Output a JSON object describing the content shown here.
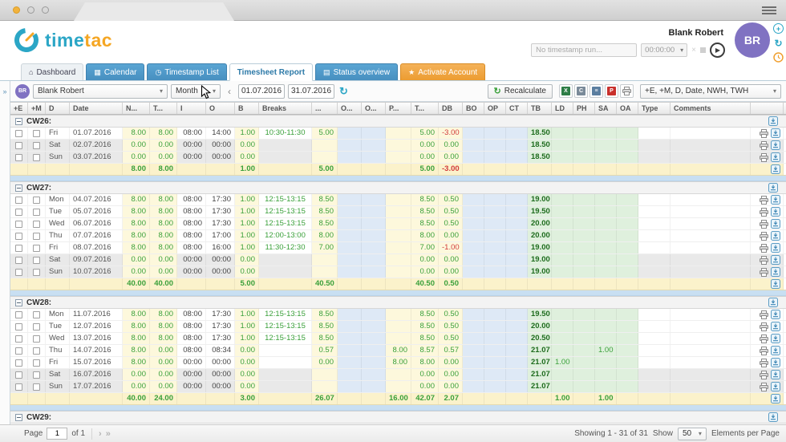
{
  "header": {
    "logo_time": "time",
    "logo_tac": "tac",
    "user_name": "Blank Robert",
    "avatar_initials": "BR",
    "timer_placeholder": "No timestamp run...",
    "timer_value": "00:00:00"
  },
  "tabs": [
    {
      "label": "Dashboard",
      "icon": "dashboard-icon"
    },
    {
      "label": "Calendar",
      "icon": "calendar-icon"
    },
    {
      "label": "Timestamp List",
      "icon": "clock-icon"
    },
    {
      "label": "Timesheet Report",
      "icon": ""
    },
    {
      "label": "Status overview",
      "icon": "chart-icon"
    },
    {
      "label": "Activate Account",
      "icon": "star-icon"
    }
  ],
  "toolbar": {
    "avatar_initials": "BR",
    "user_select_value": "Blank Robert",
    "period_select_value": "Month",
    "date_from": "01.07.2016",
    "date_to": "31.07.2016",
    "recalculate_label": "Recalculate",
    "export_icons": [
      "excel-export-icon",
      "csv-export-icon",
      "xml-export-icon",
      "pdf-export-icon",
      "print-icon"
    ],
    "columns_select_value": "+E, +M, D, Date, NWH, TWH"
  },
  "table": {
    "columns": [
      "+E",
      "+M",
      "D",
      "Date",
      "N...",
      "T...",
      "I",
      "O",
      "B",
      "Breaks",
      "...",
      "O...",
      "O...",
      "P...",
      "T...",
      "DB",
      "BO",
      "OP",
      "CT",
      "TB",
      "LD",
      "PH",
      "SA",
      "OA",
      "Type",
      "Comments",
      ""
    ],
    "groups": [
      {
        "label": "CW26:",
        "rows": [
          {
            "day": "Fri",
            "date": "01.07.2016",
            "weekend": false,
            "n": "8.00",
            "t": "8.00",
            "in": "08:00",
            "out": "14:00",
            "b": "1.00",
            "breaks": "10:30-11:30",
            "dt": "5.00",
            "p": "",
            "t2": "5.00",
            "db": "-3.00",
            "tb": "18.50",
            "ld": "",
            "ph": "",
            "sa": "",
            "oa": "",
            "type": "",
            "comments": ""
          },
          {
            "day": "Sat",
            "date": "02.07.2016",
            "weekend": true,
            "n": "0.00",
            "t": "0.00",
            "in": "00:00",
            "out": "00:00",
            "b": "0.00",
            "breaks": "",
            "dt": "",
            "p": "",
            "t2": "0.00",
            "db": "0.00",
            "tb": "18.50",
            "ld": "",
            "ph": "",
            "sa": "",
            "oa": "",
            "type": "",
            "comments": ""
          },
          {
            "day": "Sun",
            "date": "03.07.2016",
            "weekend": true,
            "n": "0.00",
            "t": "0.00",
            "in": "00:00",
            "out": "00:00",
            "b": "0.00",
            "breaks": "",
            "dt": "",
            "p": "",
            "t2": "0.00",
            "db": "0.00",
            "tb": "18.50",
            "ld": "",
            "ph": "",
            "sa": "",
            "oa": "",
            "type": "",
            "comments": ""
          }
        ],
        "summary": {
          "n": "8.00",
          "t": "8.00",
          "b": "1.00",
          "dt": "5.00",
          "p": "",
          "t2": "5.00",
          "db": "-3.00",
          "ld": "",
          "ph": "",
          "sa": ""
        }
      },
      {
        "label": "CW27:",
        "rows": [
          {
            "day": "Mon",
            "date": "04.07.2016",
            "weekend": false,
            "n": "8.00",
            "t": "8.00",
            "in": "08:00",
            "out": "17:30",
            "b": "1.00",
            "breaks": "12:15-13:15",
            "dt": "8.50",
            "p": "",
            "t2": "8.50",
            "db": "0.50",
            "tb": "19.00",
            "ld": "",
            "ph": "",
            "sa": "",
            "oa": "",
            "type": "",
            "comments": ""
          },
          {
            "day": "Tue",
            "date": "05.07.2016",
            "weekend": false,
            "n": "8.00",
            "t": "8.00",
            "in": "08:00",
            "out": "17:30",
            "b": "1.00",
            "breaks": "12:15-13:15",
            "dt": "8.50",
            "p": "",
            "t2": "8.50",
            "db": "0.50",
            "tb": "19.50",
            "ld": "",
            "ph": "",
            "sa": "",
            "oa": "",
            "type": "",
            "comments": ""
          },
          {
            "day": "Wed",
            "date": "06.07.2016",
            "weekend": false,
            "n": "8.00",
            "t": "8.00",
            "in": "08:00",
            "out": "17:30",
            "b": "1.00",
            "breaks": "12:15-13:15",
            "dt": "8.50",
            "p": "",
            "t2": "8.50",
            "db": "0.50",
            "tb": "20.00",
            "ld": "",
            "ph": "",
            "sa": "",
            "oa": "",
            "type": "",
            "comments": ""
          },
          {
            "day": "Thu",
            "date": "07.07.2016",
            "weekend": false,
            "n": "8.00",
            "t": "8.00",
            "in": "08:00",
            "out": "17:00",
            "b": "1.00",
            "breaks": "12:00-13:00",
            "dt": "8.00",
            "p": "",
            "t2": "8.00",
            "db": "0.00",
            "tb": "20.00",
            "ld": "",
            "ph": "",
            "sa": "",
            "oa": "",
            "type": "",
            "comments": ""
          },
          {
            "day": "Fri",
            "date": "08.07.2016",
            "weekend": false,
            "n": "8.00",
            "t": "8.00",
            "in": "08:00",
            "out": "16:00",
            "b": "1.00",
            "breaks": "11:30-12:30",
            "dt": "7.00",
            "p": "",
            "t2": "7.00",
            "db": "-1.00",
            "tb": "19.00",
            "ld": "",
            "ph": "",
            "sa": "",
            "oa": "",
            "type": "",
            "comments": ""
          },
          {
            "day": "Sat",
            "date": "09.07.2016",
            "weekend": true,
            "n": "0.00",
            "t": "0.00",
            "in": "00:00",
            "out": "00:00",
            "b": "0.00",
            "breaks": "",
            "dt": "",
            "p": "",
            "t2": "0.00",
            "db": "0.00",
            "tb": "19.00",
            "ld": "",
            "ph": "",
            "sa": "",
            "oa": "",
            "type": "",
            "comments": ""
          },
          {
            "day": "Sun",
            "date": "10.07.2016",
            "weekend": true,
            "n": "0.00",
            "t": "0.00",
            "in": "00:00",
            "out": "00:00",
            "b": "0.00",
            "breaks": "",
            "dt": "",
            "p": "",
            "t2": "0.00",
            "db": "0.00",
            "tb": "19.00",
            "ld": "",
            "ph": "",
            "sa": "",
            "oa": "",
            "type": "",
            "comments": ""
          }
        ],
        "summary": {
          "n": "40.00",
          "t": "40.00",
          "b": "5.00",
          "dt": "40.50",
          "p": "",
          "t2": "40.50",
          "db": "0.50",
          "ld": "",
          "ph": "",
          "sa": ""
        }
      },
      {
        "label": "CW28:",
        "rows": [
          {
            "day": "Mon",
            "date": "11.07.2016",
            "weekend": false,
            "n": "8.00",
            "t": "8.00",
            "in": "08:00",
            "out": "17:30",
            "b": "1.00",
            "breaks": "12:15-13:15",
            "dt": "8.50",
            "p": "",
            "t2": "8.50",
            "db": "0.50",
            "tb": "19.50",
            "ld": "",
            "ph": "",
            "sa": "",
            "oa": "",
            "type": "",
            "comments": ""
          },
          {
            "day": "Tue",
            "date": "12.07.2016",
            "weekend": false,
            "n": "8.00",
            "t": "8.00",
            "in": "08:00",
            "out": "17:30",
            "b": "1.00",
            "breaks": "12:15-13:15",
            "dt": "8.50",
            "p": "",
            "t2": "8.50",
            "db": "0.50",
            "tb": "20.00",
            "ld": "",
            "ph": "",
            "sa": "",
            "oa": "",
            "type": "",
            "comments": ""
          },
          {
            "day": "Wed",
            "date": "13.07.2016",
            "weekend": false,
            "n": "8.00",
            "t": "8.00",
            "in": "08:00",
            "out": "17:30",
            "b": "1.00",
            "breaks": "12:15-13:15",
            "dt": "8.50",
            "p": "",
            "t2": "8.50",
            "db": "0.50",
            "tb": "20.50",
            "ld": "",
            "ph": "",
            "sa": "",
            "oa": "",
            "type": "",
            "comments": ""
          },
          {
            "day": "Thu",
            "date": "14.07.2016",
            "weekend": false,
            "n": "8.00",
            "t": "0.00",
            "in": "08:00",
            "out": "08:34",
            "b": "0.00",
            "breaks": "",
            "dt": "0.57",
            "p": "8.00",
            "t2": "8.57",
            "db": "0.57",
            "tb": "21.07",
            "ld": "",
            "ph": "",
            "sa": "1.00",
            "oa": "",
            "type": "",
            "comments": ""
          },
          {
            "day": "Fri",
            "date": "15.07.2016",
            "weekend": false,
            "n": "8.00",
            "t": "0.00",
            "in": "00:00",
            "out": "00:00",
            "b": "0.00",
            "breaks": "",
            "dt": "0.00",
            "p": "8.00",
            "t2": "8.00",
            "db": "0.00",
            "tb": "21.07",
            "ld": "1.00",
            "ph": "",
            "sa": "",
            "oa": "",
            "type": "",
            "comments": ""
          },
          {
            "day": "Sat",
            "date": "16.07.2016",
            "weekend": true,
            "n": "0.00",
            "t": "0.00",
            "in": "00:00",
            "out": "00:00",
            "b": "0.00",
            "breaks": "",
            "dt": "",
            "p": "",
            "t2": "0.00",
            "db": "0.00",
            "tb": "21.07",
            "ld": "",
            "ph": "",
            "sa": "",
            "oa": "",
            "type": "",
            "comments": ""
          },
          {
            "day": "Sun",
            "date": "17.07.2016",
            "weekend": true,
            "n": "0.00",
            "t": "0.00",
            "in": "00:00",
            "out": "00:00",
            "b": "0.00",
            "breaks": "",
            "dt": "",
            "p": "",
            "t2": "0.00",
            "db": "0.00",
            "tb": "21.07",
            "ld": "",
            "ph": "",
            "sa": "",
            "oa": "",
            "type": "",
            "comments": ""
          }
        ],
        "summary": {
          "n": "40.00",
          "t": "24.00",
          "b": "3.00",
          "dt": "26.07",
          "p": "16.00",
          "t2": "42.07",
          "db": "2.07",
          "ld": "1.00",
          "ph": "",
          "sa": "1.00"
        }
      },
      {
        "label": "CW29:",
        "rows": [],
        "summary": null
      }
    ]
  },
  "footer": {
    "page_label": "Page",
    "page_value": "1",
    "of_label": "of 1",
    "showing": "Showing 1 - 31 of 31",
    "show_label": "Show",
    "page_size": "50",
    "elements_label": "Elements per Page"
  },
  "colors": {
    "accent_teal": "#2ba6c6",
    "accent_orange": "#f5a623",
    "tab_blue": "#4f9bcb",
    "avatar_purple": "#8072c2",
    "positive_green": "#3aa03a",
    "negative_red": "#d23c3c",
    "col_yellow": "#fdf8dc",
    "col_blue": "#dee9f6",
    "col_green": "#dff0dd",
    "summary_yellow": "#fbf2cb",
    "separator_blue": "#c8dff2"
  }
}
